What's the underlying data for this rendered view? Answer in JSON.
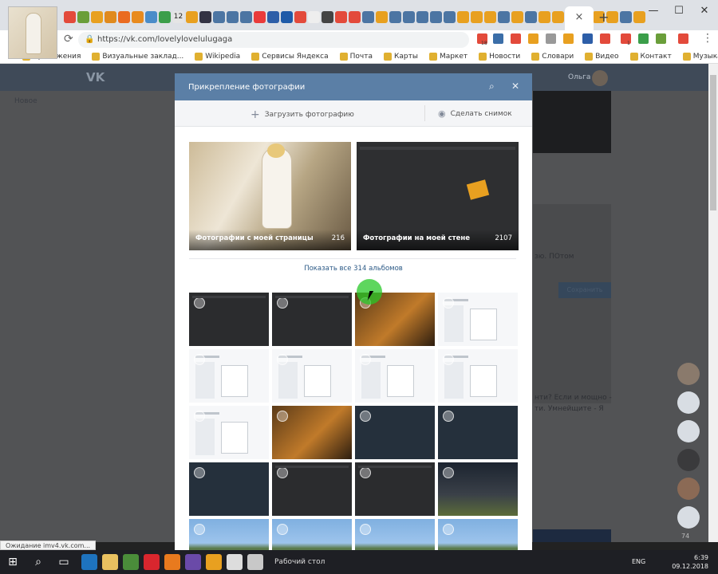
{
  "browser": {
    "url": "https://vk.com/lovelylovelulugaga",
    "active_tab_close": "×",
    "new_tab": "+",
    "window_controls": [
      "—",
      "☐",
      "✕"
    ],
    "tabs_colors": [
      "#e34a3b",
      "#6a9e3a",
      "#e8a020",
      "#e08a1e",
      "#ea6b21",
      "#e88a1e",
      "#4a8cc9",
      "#3b9e4a",
      "#e5e5e5",
      "#e8a020",
      "#334",
      "#4c75a3",
      "#4c75a3",
      "#4c75a3",
      "#ea3b3b",
      "#2d5ea8",
      "#1e5aa8",
      "#e34a3b",
      "#eee",
      "#444",
      "#e34a3b",
      "#e34a3b",
      "#4c75a3",
      "#e8a020",
      "#4c75a3",
      "#4c75a3",
      "#4c75a3",
      "#4c75a3",
      "#4c75a3",
      "#e8a020",
      "#e8a020",
      "#e8a020",
      "#4c75a3",
      "#e8a020",
      "#4c75a3",
      "#e8a020",
      "#e8a020",
      "#e8a020",
      "#e34a3b",
      "#e8a020",
      "#e8a020",
      "#4c75a3",
      "#e8a020"
    ],
    "tab_label_12": "12",
    "ext_badge": "18",
    "ext_badge_2": "1"
  },
  "bookmarks": [
    {
      "label": "Приложения"
    },
    {
      "label": "Визуальные заклад..."
    },
    {
      "label": "Wikipedia"
    },
    {
      "label": "Сервисы Яндекса"
    },
    {
      "label": "Почта"
    },
    {
      "label": "Карты"
    },
    {
      "label": "Маркет"
    },
    {
      "label": "Новости"
    },
    {
      "label": "Словари"
    },
    {
      "label": "Видео"
    },
    {
      "label": "Контакт"
    },
    {
      "label": "Музыка"
    }
  ],
  "vk": {
    "logo": "VK",
    "user_name": "Ольга",
    "left_menu_item": "Новое",
    "bg_text_1": "зю. ПОтом",
    "bg_text_2": "Сохранить",
    "bg_text_3": "нти? Если и мощно -",
    "bg_text_4": "ти. Умнейщите - Я",
    "dock_count": "74"
  },
  "modal": {
    "title": "Прикрепление фотографии",
    "upload_label": "Загрузить фотографию",
    "snapshot_label": "Сделать снимок",
    "albums": [
      {
        "title": "Фотографии с моей страницы",
        "count": "216"
      },
      {
        "title": "Фотографии на моей стене",
        "count": "2107"
      }
    ],
    "show_all": "Показать все 314 альбомов"
  },
  "photos": [
    {
      "style": "dark"
    },
    {
      "style": "dark"
    },
    {
      "style": "warm"
    },
    {
      "style": "light"
    },
    {
      "style": "light"
    },
    {
      "style": "light"
    },
    {
      "style": "light"
    },
    {
      "style": "light"
    },
    {
      "style": "light"
    },
    {
      "style": "warm"
    },
    {
      "style": "navy"
    },
    {
      "style": "navy"
    },
    {
      "style": "navy"
    },
    {
      "style": "dark"
    },
    {
      "style": "dark"
    },
    {
      "style": "truck"
    },
    {
      "style": "road"
    },
    {
      "style": "road"
    },
    {
      "style": "road"
    },
    {
      "style": "road"
    }
  ],
  "status_bar": "Ожидание imv4.vk.com...",
  "taskbar": {
    "desktop_label": "Рабочий стол",
    "lang": "ENG",
    "time": "6:39",
    "date": "09.12.2018"
  }
}
